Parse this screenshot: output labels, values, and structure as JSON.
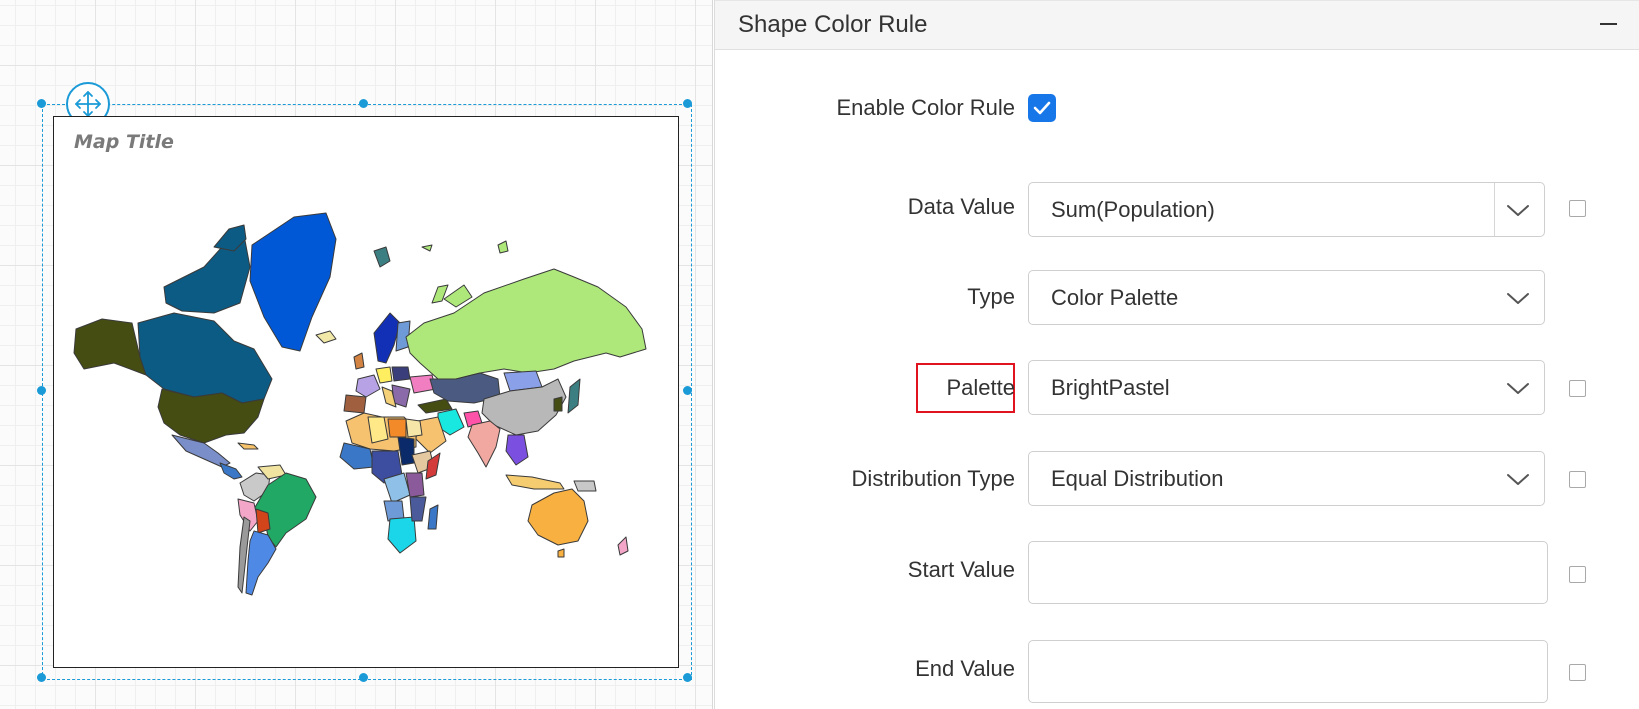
{
  "canvas": {
    "map_title": "Map Title"
  },
  "panel": {
    "title": "Shape Color Rule",
    "collapse_icon": "minus-icon",
    "enable_color_rule": {
      "label": "Enable Color Rule",
      "checked": true
    },
    "data_value": {
      "label": "Data Value",
      "value": "Sum(Population)"
    },
    "type": {
      "label": "Type",
      "value": "Color Palette"
    },
    "palette": {
      "label": "Palette",
      "value": "BrightPastel"
    },
    "distribution_type": {
      "label": "Distribution Type",
      "value": "Equal Distribution"
    },
    "start_value": {
      "label": "Start Value",
      "value": ""
    },
    "end_value": {
      "label": "End Value",
      "value": ""
    }
  },
  "colors": {
    "accent": "#1a9ad6",
    "checkbox": "#1877e8",
    "highlight": "#e0131f"
  }
}
